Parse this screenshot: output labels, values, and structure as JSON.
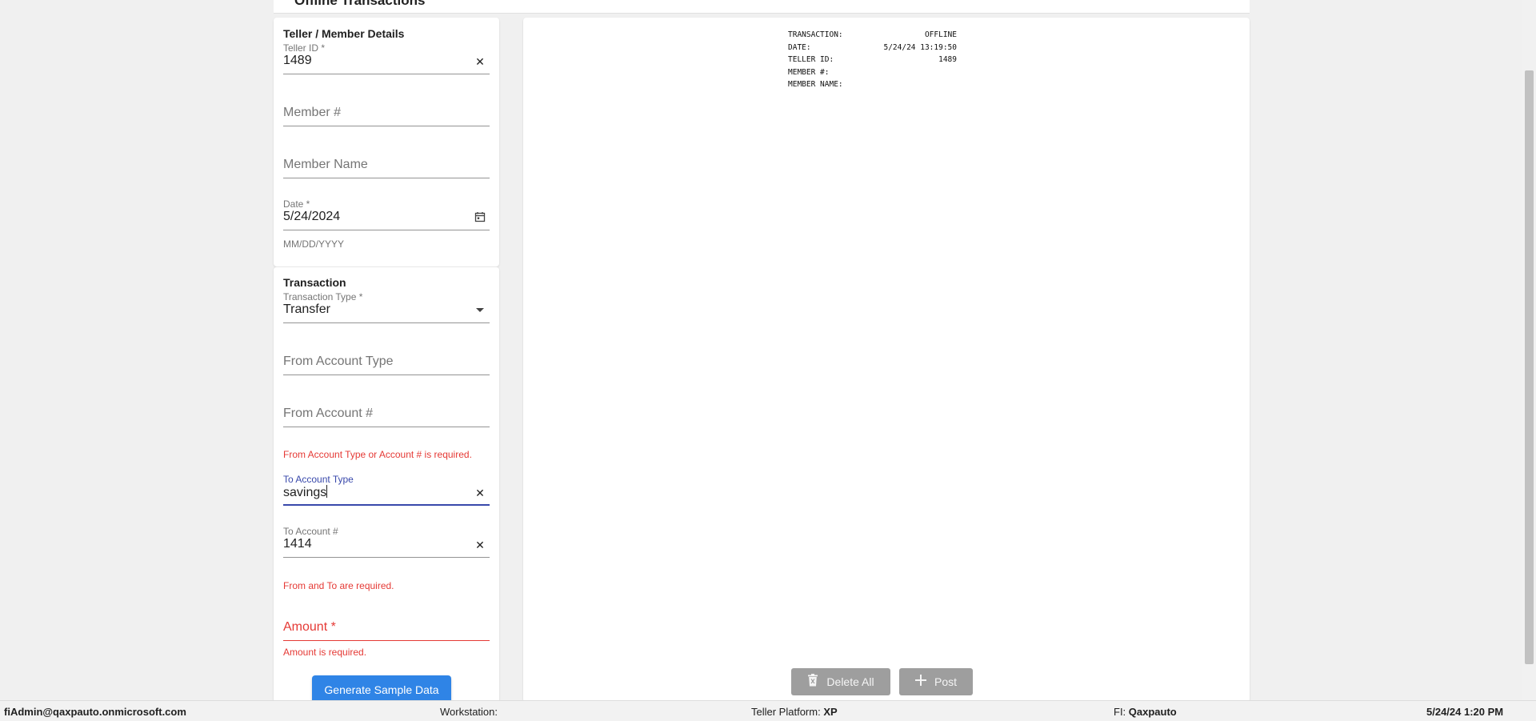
{
  "page": {
    "title": "Offline Transactions"
  },
  "teller_section": {
    "title": "Teller / Member Details",
    "teller_id": {
      "label": "Teller ID *",
      "value": "1489"
    },
    "member_number": {
      "placeholder": "Member #"
    },
    "member_name": {
      "placeholder": "Member Name"
    },
    "date": {
      "label": "Date *",
      "value": "5/24/2024",
      "helper": "MM/DD/YYYY"
    }
  },
  "transaction_section": {
    "title": "Transaction",
    "transaction_type": {
      "label": "Transaction Type *",
      "value": "Transfer"
    },
    "from_account_type": {
      "placeholder": "From Account Type"
    },
    "from_account_number": {
      "placeholder": "From Account #"
    },
    "from_error": "From Account Type or Account # is required.",
    "to_account_type": {
      "label": "To Account Type",
      "value": "savings"
    },
    "to_account_number": {
      "label": "To Account #",
      "value": "1414"
    },
    "to_error": "From and To are required.",
    "amount": {
      "placeholder": "Amount *"
    },
    "amount_error": "Amount is required.",
    "sample_button": "Generate Sample Data"
  },
  "receipt": {
    "rows": [
      {
        "label": "TRANSACTION:",
        "value": "OFFLINE"
      },
      {
        "label": "DATE:",
        "value": "5/24/24 13:19:50"
      },
      {
        "label": "TELLER ID:",
        "value": "1489"
      },
      {
        "label": "MEMBER #:",
        "value": ""
      },
      {
        "label": "MEMBER NAME:",
        "value": ""
      }
    ]
  },
  "actions": {
    "delete_all": "Delete All",
    "post": "Post"
  },
  "footer": {
    "user": "fiAdmin@qaxpauto.onmicrosoft.com",
    "workstation_label": "Workstation:",
    "teller_platform_label": "Teller Platform:",
    "teller_platform_value": "XP",
    "fi_label": "FI:",
    "fi_value": "Qaxpauto",
    "datetime": "5/24/24 1:20 PM"
  },
  "icons": {
    "clear": "close-icon",
    "calendar": "calendar-icon",
    "dropdown": "caret-down-icon",
    "trash": "trash-icon",
    "plus": "plus-icon"
  }
}
